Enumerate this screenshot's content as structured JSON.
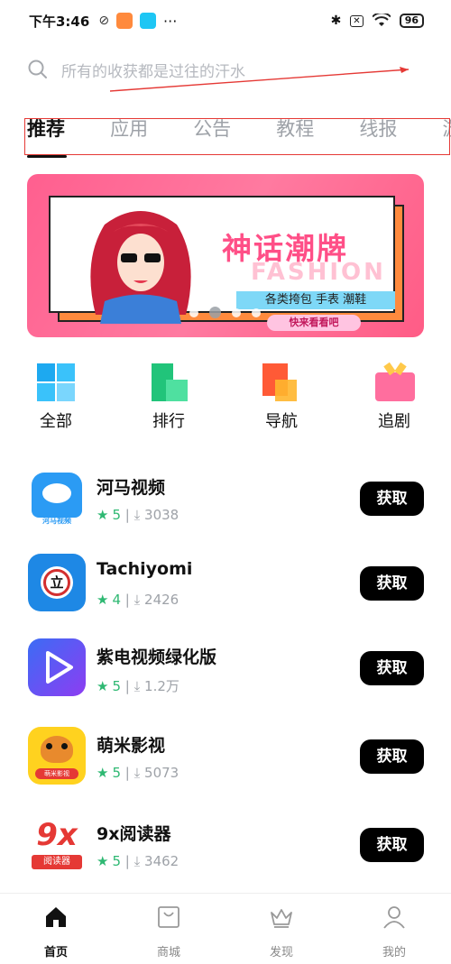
{
  "status": {
    "time": "下午3:46",
    "battery": "96",
    "more": "···"
  },
  "search": {
    "placeholder": "所有的收获都是过往的汗水"
  },
  "tabs": [
    {
      "label": "推荐"
    },
    {
      "label": "应用"
    },
    {
      "label": "公告"
    },
    {
      "label": "教程"
    },
    {
      "label": "线报"
    },
    {
      "label": "游"
    }
  ],
  "banner": {
    "title": "神话潮牌",
    "fashion": "FASHION",
    "subtitle": "各类挎包 手表 潮鞋",
    "cta": "快来看看吧"
  },
  "categories": [
    {
      "label": "全部",
      "icon": "grid-icon"
    },
    {
      "label": "排行",
      "icon": "ranking-icon"
    },
    {
      "label": "导航",
      "icon": "navigation-icon"
    },
    {
      "label": "追剧",
      "icon": "tv-icon"
    }
  ],
  "apps": [
    {
      "name": "河马视频",
      "rating": "5",
      "downloads": "3038",
      "button": "获取",
      "icon": "hippo-video-icon",
      "icon_text": "河马视频"
    },
    {
      "name": "Tachiyomi",
      "rating": "4",
      "downloads": "2426",
      "button": "获取",
      "icon": "tachiyomi-icon",
      "icon_text": "立"
    },
    {
      "name": "紫电视频绿化版",
      "rating": "5",
      "downloads": "1.2万",
      "button": "获取",
      "icon": "play-icon"
    },
    {
      "name": "萌米影视",
      "rating": "5",
      "downloads": "5073",
      "button": "获取",
      "icon": "camel-icon",
      "icon_text": "萌米影视"
    },
    {
      "name": "9x阅读器",
      "rating": "5",
      "downloads": "3462",
      "button": "获取",
      "icon": "reader-icon",
      "icon_text": "9x",
      "icon_sub": "阅读器"
    }
  ],
  "nav": [
    {
      "label": "首页",
      "icon": "home-icon"
    },
    {
      "label": "商城",
      "icon": "shopping-bag-icon"
    },
    {
      "label": "发现",
      "icon": "crown-icon"
    },
    {
      "label": "我的",
      "icon": "user-icon"
    }
  ],
  "colors": {
    "accent": "#2eb872",
    "button": "#000000",
    "banner": "#ff6f96"
  }
}
